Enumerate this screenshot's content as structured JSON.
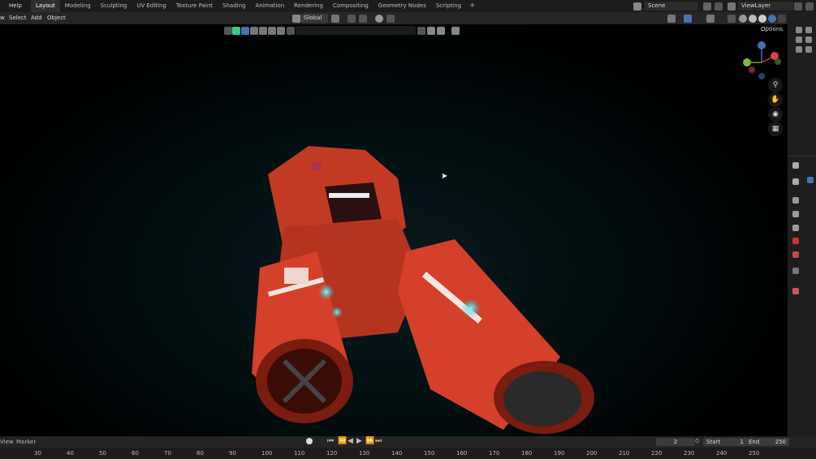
{
  "menu": {
    "help": "Help"
  },
  "workspace_tabs": [
    "Layout",
    "Modeling",
    "Sculpting",
    "UV Editing",
    "Texture Paint",
    "Shading",
    "Animation",
    "Rendering",
    "Compositing",
    "Geometry Nodes",
    "Scripting"
  ],
  "add_tab": "+",
  "scene": "Scene",
  "view_layer": "ViewLayer",
  "header": {
    "view": "w",
    "select": "Select",
    "add": "Add",
    "object": "Object",
    "orientation": "Global",
    "options": "Options"
  },
  "gizmo_labels": {
    "x": "X",
    "y": "Y",
    "z": "Z"
  },
  "timeline": {
    "view": "View",
    "marker": "Marker",
    "current_frame": "2",
    "start_label": "Start",
    "start": "1",
    "end_label": "End",
    "end": "250",
    "ticks": [
      "30",
      "40",
      "50",
      "60",
      "70",
      "80",
      "90",
      "100",
      "110",
      "120",
      "130",
      "140",
      "150",
      "160",
      "170",
      "180",
      "190",
      "200",
      "210",
      "220",
      "230",
      "240",
      "250"
    ]
  },
  "colors": {
    "accent": "#4772b3",
    "hull": "#d4402a",
    "glow": "#27c4e0"
  }
}
